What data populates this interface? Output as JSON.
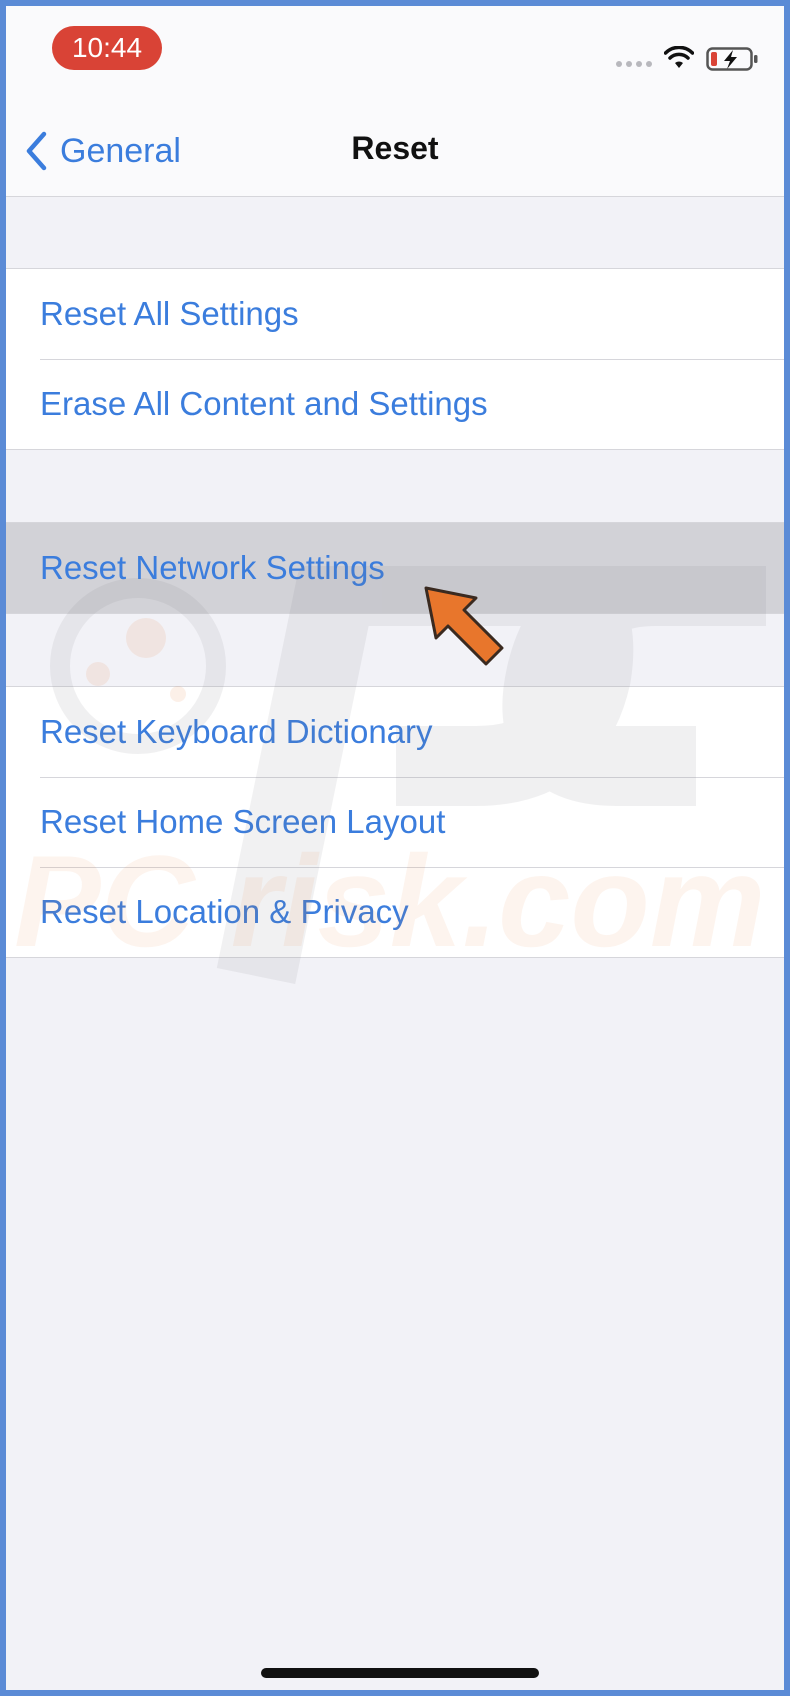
{
  "status_bar": {
    "time": "10:44",
    "time_pill_color": "#d94336",
    "icons": [
      "signal-dots-icon",
      "wifi-icon",
      "battery-charging-icon"
    ]
  },
  "nav": {
    "back_label": "General",
    "title": "Reset"
  },
  "groups": [
    {
      "items": [
        "Reset All Settings",
        "Erase All Content and Settings"
      ]
    },
    {
      "items": [
        "Reset Network Settings"
      ]
    },
    {
      "items": [
        "Reset Keyboard Dictionary",
        "Reset Home Screen Layout",
        "Reset Location & Privacy"
      ]
    }
  ],
  "highlighted_item": "Reset Network Settings",
  "watermark_text": "PC risk.com",
  "colors": {
    "accent": "#3b7ddd",
    "background": "#f2f2f7",
    "highlight": "#d2d2d7",
    "arrow": "#e8762c"
  }
}
